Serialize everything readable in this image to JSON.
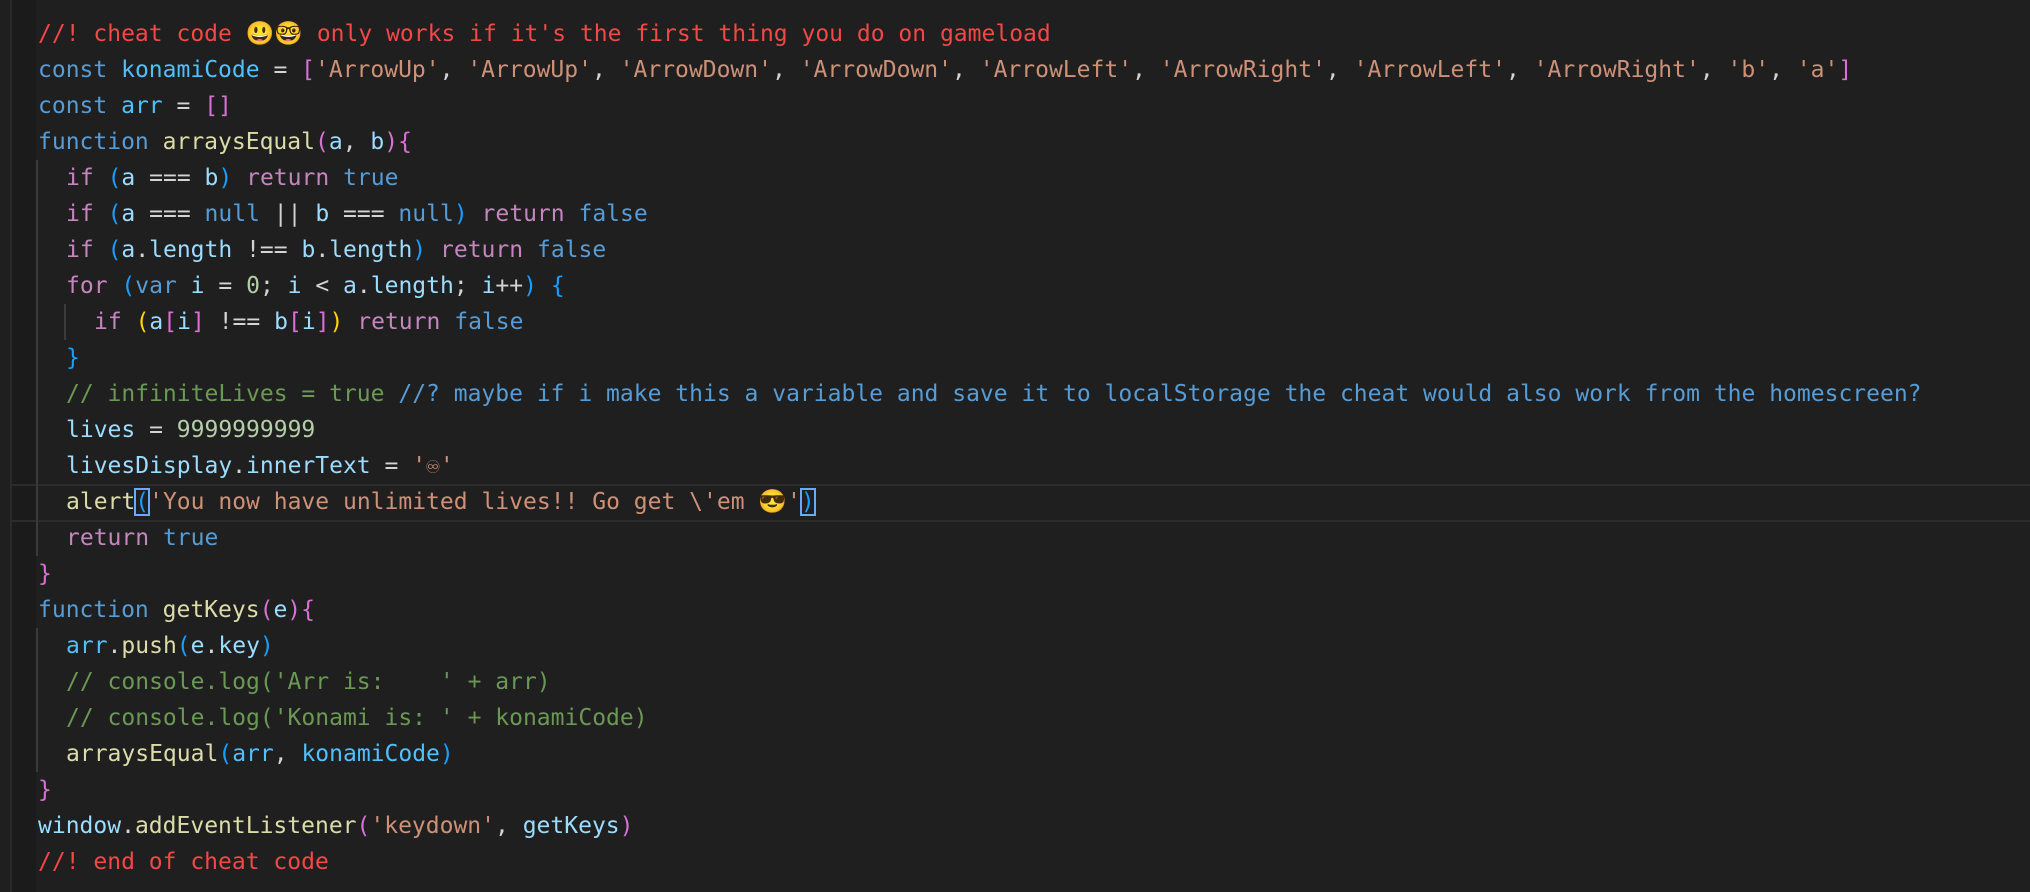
{
  "colors": {
    "background": "#1f1f1f",
    "comment_red": "#f44747",
    "comment_green": "#6a9955",
    "comment_blue": "#569cd6",
    "keyword_blue": "#569cd6",
    "control_purple": "#c586c0",
    "function_yellow": "#dcdcaa",
    "variable": "#9cdcfe",
    "const_var": "#4fc1ff",
    "string": "#ce9178",
    "number": "#b5cea8",
    "plain": "#d4d4d4",
    "bracket_gold": "#ffd700",
    "bracket_pink": "#da70d6",
    "bracket_blue": "#179fff"
  },
  "lines": [
    {
      "indent": 0,
      "tokens": [
        [
          "//! cheat code 😃🤓 only works if it's the first thing you do on gameload",
          "comment_red"
        ]
      ]
    },
    {
      "indent": 0,
      "tokens": [
        [
          "const",
          "keyword_blue"
        ],
        [
          " ",
          "plain"
        ],
        [
          "konamiCode",
          "const_var"
        ],
        [
          " = ",
          "plain"
        ],
        [
          "[",
          "bracket_pink"
        ],
        [
          "'ArrowUp'",
          "string"
        ],
        [
          ", ",
          "plain"
        ],
        [
          "'ArrowUp'",
          "string"
        ],
        [
          ", ",
          "plain"
        ],
        [
          "'ArrowDown'",
          "string"
        ],
        [
          ", ",
          "plain"
        ],
        [
          "'ArrowDown'",
          "string"
        ],
        [
          ", ",
          "plain"
        ],
        [
          "'ArrowLeft'",
          "string"
        ],
        [
          ", ",
          "plain"
        ],
        [
          "'ArrowRight'",
          "string"
        ],
        [
          ", ",
          "plain"
        ],
        [
          "'ArrowLeft'",
          "string"
        ],
        [
          ", ",
          "plain"
        ],
        [
          "'ArrowRight'",
          "string"
        ],
        [
          ", ",
          "plain"
        ],
        [
          "'b'",
          "string"
        ],
        [
          ", ",
          "plain"
        ],
        [
          "'a'",
          "string"
        ],
        [
          "]",
          "bracket_pink"
        ]
      ]
    },
    {
      "indent": 0,
      "tokens": [
        [
          "const",
          "keyword_blue"
        ],
        [
          " ",
          "plain"
        ],
        [
          "arr",
          "const_var"
        ],
        [
          " = ",
          "plain"
        ],
        [
          "[]",
          "bracket_pink"
        ]
      ]
    },
    {
      "indent": 0,
      "tokens": [
        [
          "function",
          "keyword_blue"
        ],
        [
          " ",
          "plain"
        ],
        [
          "arraysEqual",
          "function_yellow"
        ],
        [
          "(",
          "bracket_pink"
        ],
        [
          "a",
          "variable"
        ],
        [
          ", ",
          "plain"
        ],
        [
          "b",
          "variable"
        ],
        [
          ")",
          "bracket_pink"
        ],
        [
          "{",
          "bracket_pink"
        ]
      ]
    },
    {
      "indent": 1,
      "tokens": [
        [
          "if",
          "control_purple"
        ],
        [
          " ",
          "plain"
        ],
        [
          "(",
          "bracket_blue"
        ],
        [
          "a",
          "variable"
        ],
        [
          " === ",
          "plain"
        ],
        [
          "b",
          "variable"
        ],
        [
          ")",
          "bracket_blue"
        ],
        [
          " ",
          "plain"
        ],
        [
          "return",
          "control_purple"
        ],
        [
          " ",
          "plain"
        ],
        [
          "true",
          "keyword_blue"
        ]
      ]
    },
    {
      "indent": 1,
      "tokens": [
        [
          "if",
          "control_purple"
        ],
        [
          " ",
          "plain"
        ],
        [
          "(",
          "bracket_blue"
        ],
        [
          "a",
          "variable"
        ],
        [
          " === ",
          "plain"
        ],
        [
          "null",
          "keyword_blue"
        ],
        [
          " || ",
          "plain"
        ],
        [
          "b",
          "variable"
        ],
        [
          " === ",
          "plain"
        ],
        [
          "null",
          "keyword_blue"
        ],
        [
          ")",
          "bracket_blue"
        ],
        [
          " ",
          "plain"
        ],
        [
          "return",
          "control_purple"
        ],
        [
          " ",
          "plain"
        ],
        [
          "false",
          "keyword_blue"
        ]
      ]
    },
    {
      "indent": 1,
      "tokens": [
        [
          "if",
          "control_purple"
        ],
        [
          " ",
          "plain"
        ],
        [
          "(",
          "bracket_blue"
        ],
        [
          "a",
          "variable"
        ],
        [
          ".",
          "plain"
        ],
        [
          "length",
          "variable"
        ],
        [
          " !== ",
          "plain"
        ],
        [
          "b",
          "variable"
        ],
        [
          ".",
          "plain"
        ],
        [
          "length",
          "variable"
        ],
        [
          ")",
          "bracket_blue"
        ],
        [
          " ",
          "plain"
        ],
        [
          "return",
          "control_purple"
        ],
        [
          " ",
          "plain"
        ],
        [
          "false",
          "keyword_blue"
        ]
      ]
    },
    {
      "indent": 1,
      "tokens": [
        [
          "for",
          "control_purple"
        ],
        [
          " ",
          "plain"
        ],
        [
          "(",
          "bracket_blue"
        ],
        [
          "var",
          "keyword_blue"
        ],
        [
          " ",
          "plain"
        ],
        [
          "i",
          "variable"
        ],
        [
          " = ",
          "plain"
        ],
        [
          "0",
          "number"
        ],
        [
          "; ",
          "plain"
        ],
        [
          "i",
          "variable"
        ],
        [
          " < ",
          "plain"
        ],
        [
          "a",
          "variable"
        ],
        [
          ".",
          "plain"
        ],
        [
          "length",
          "variable"
        ],
        [
          "; ",
          "plain"
        ],
        [
          "i",
          "variable"
        ],
        [
          "++",
          "plain"
        ],
        [
          ")",
          "bracket_blue"
        ],
        [
          " ",
          "plain"
        ],
        [
          "{",
          "bracket_blue"
        ]
      ]
    },
    {
      "indent": 2,
      "tokens": [
        [
          "if",
          "control_purple"
        ],
        [
          " ",
          "plain"
        ],
        [
          "(",
          "bracket_gold"
        ],
        [
          "a",
          "variable"
        ],
        [
          "[",
          "bracket_pink"
        ],
        [
          "i",
          "variable"
        ],
        [
          "]",
          "bracket_pink"
        ],
        [
          " !== ",
          "plain"
        ],
        [
          "b",
          "variable"
        ],
        [
          "[",
          "bracket_pink"
        ],
        [
          "i",
          "variable"
        ],
        [
          "]",
          "bracket_pink"
        ],
        [
          ")",
          "bracket_gold"
        ],
        [
          " ",
          "plain"
        ],
        [
          "return",
          "control_purple"
        ],
        [
          " ",
          "plain"
        ],
        [
          "false",
          "keyword_blue"
        ]
      ]
    },
    {
      "indent": 1,
      "tokens": [
        [
          "}",
          "bracket_blue"
        ]
      ]
    },
    {
      "indent": 1,
      "tokens": [
        [
          "// infiniteLives = true ",
          "comment_green"
        ],
        [
          "//? maybe if i make this a variable and save it to localStorage the cheat would also work from the homescreen?",
          "comment_blue"
        ]
      ]
    },
    {
      "indent": 1,
      "tokens": [
        [
          "lives",
          "variable"
        ],
        [
          " = ",
          "plain"
        ],
        [
          "9999999999",
          "number"
        ]
      ]
    },
    {
      "indent": 1,
      "tokens": [
        [
          "livesDisplay",
          "variable"
        ],
        [
          ".",
          "plain"
        ],
        [
          "innerText",
          "variable"
        ],
        [
          " = ",
          "plain"
        ],
        [
          "'♾'",
          "string"
        ]
      ]
    },
    {
      "indent": 1,
      "active": true,
      "tokens": [
        [
          "alert",
          "function_yellow"
        ],
        [
          "(",
          "bracket_blue_box"
        ],
        [
          "'You now have unlimited lives!! Go get \\'em 😎'",
          "string"
        ],
        [
          ")",
          "bracket_blue_box"
        ]
      ]
    },
    {
      "indent": 1,
      "tokens": [
        [
          "return",
          "control_purple"
        ],
        [
          " ",
          "plain"
        ],
        [
          "true",
          "keyword_blue"
        ]
      ]
    },
    {
      "indent": 0,
      "tokens": [
        [
          "}",
          "bracket_pink"
        ]
      ]
    },
    {
      "indent": 0,
      "tokens": [
        [
          "function",
          "keyword_blue"
        ],
        [
          " ",
          "plain"
        ],
        [
          "getKeys",
          "function_yellow"
        ],
        [
          "(",
          "bracket_pink"
        ],
        [
          "e",
          "variable"
        ],
        [
          ")",
          "bracket_pink"
        ],
        [
          "{",
          "bracket_pink"
        ]
      ]
    },
    {
      "indent": 1,
      "tokens": [
        [
          "arr",
          "const_var"
        ],
        [
          ".",
          "plain"
        ],
        [
          "push",
          "function_yellow"
        ],
        [
          "(",
          "bracket_blue"
        ],
        [
          "e",
          "variable"
        ],
        [
          ".",
          "plain"
        ],
        [
          "key",
          "variable"
        ],
        [
          ")",
          "bracket_blue"
        ]
      ]
    },
    {
      "indent": 1,
      "tokens": [
        [
          "// console.log('Arr is:    ' + arr)",
          "comment_green"
        ]
      ]
    },
    {
      "indent": 1,
      "tokens": [
        [
          "// console.log('Konami is: ' + konamiCode)",
          "comment_green"
        ]
      ]
    },
    {
      "indent": 1,
      "tokens": [
        [
          "arraysEqual",
          "function_yellow"
        ],
        [
          "(",
          "bracket_blue"
        ],
        [
          "arr",
          "const_var"
        ],
        [
          ", ",
          "plain"
        ],
        [
          "konamiCode",
          "const_var"
        ],
        [
          ")",
          "bracket_blue"
        ]
      ]
    },
    {
      "indent": 0,
      "tokens": [
        [
          "}",
          "bracket_pink"
        ]
      ]
    },
    {
      "indent": 0,
      "tokens": [
        [
          "window",
          "variable"
        ],
        [
          ".",
          "plain"
        ],
        [
          "addEventListener",
          "function_yellow"
        ],
        [
          "(",
          "bracket_pink"
        ],
        [
          "'keydown'",
          "string"
        ],
        [
          ", ",
          "plain"
        ],
        [
          "getKeys",
          "variable"
        ],
        [
          ")",
          "bracket_pink"
        ]
      ]
    },
    {
      "indent": 0,
      "tokens": [
        [
          "//! end of cheat code",
          "comment_red"
        ]
      ]
    }
  ]
}
